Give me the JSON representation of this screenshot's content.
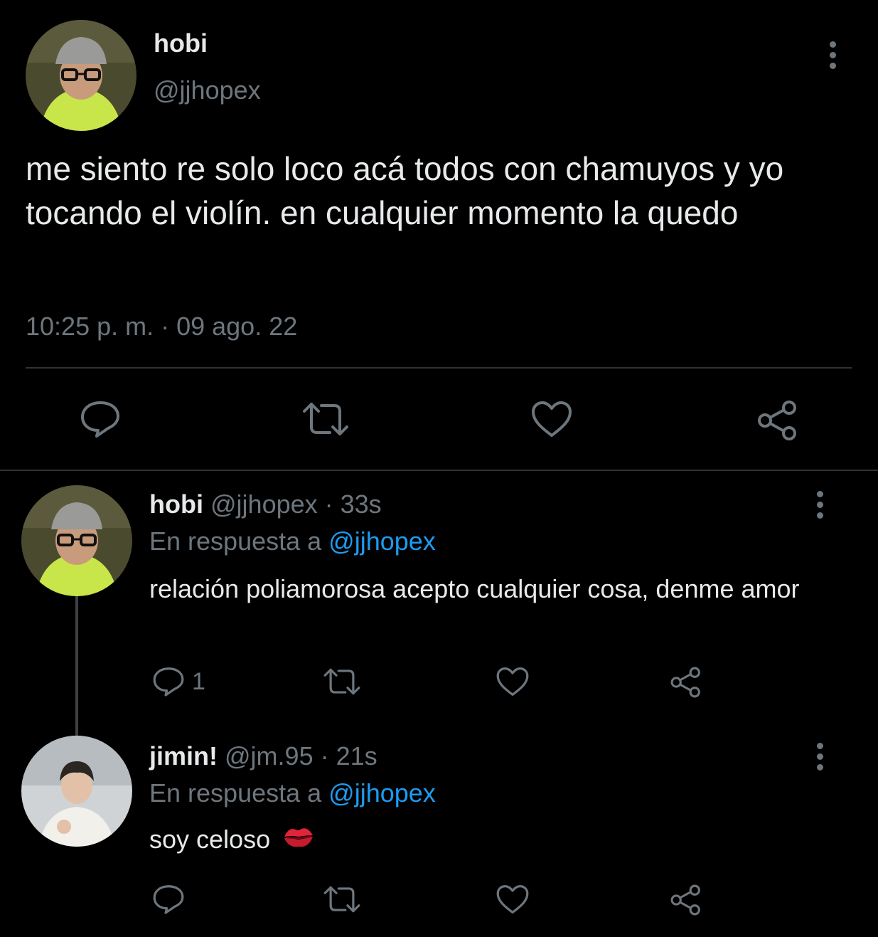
{
  "main_tweet": {
    "display_name": "hobi",
    "handle": "@jjhopex",
    "text": "me siento re solo loco acá todos con chamuyos y yo tocando el violín. en cualquier momento la quedo",
    "timestamp": "10:25 p. m. · 09 ago. 22",
    "actions": [
      "reply-icon",
      "retweet-icon",
      "like-icon",
      "share-icon"
    ]
  },
  "replies": [
    {
      "display_name": "hobi",
      "handle_time": "@jjhopex · 33s",
      "reply_prefix": "En respuesta a",
      "reply_mention": "@jjhopex",
      "text": "relación poliamorosa acepto cualquier cosa, denme amor",
      "reply_count": "1"
    },
    {
      "display_name": "jimin!",
      "handle_time": "@jm.95 · 21s",
      "reply_prefix": "En respuesta a",
      "reply_mention": "@jjhopex",
      "text": "soy celoso",
      "emoji": "kiss-mark-icon",
      "reply_count": ""
    }
  ],
  "colors": {
    "background": "#000000",
    "primary_text": "#e7e9ea",
    "secondary_text": "#6e767d",
    "link": "#1d9bf0",
    "divider": "#2f3336"
  }
}
